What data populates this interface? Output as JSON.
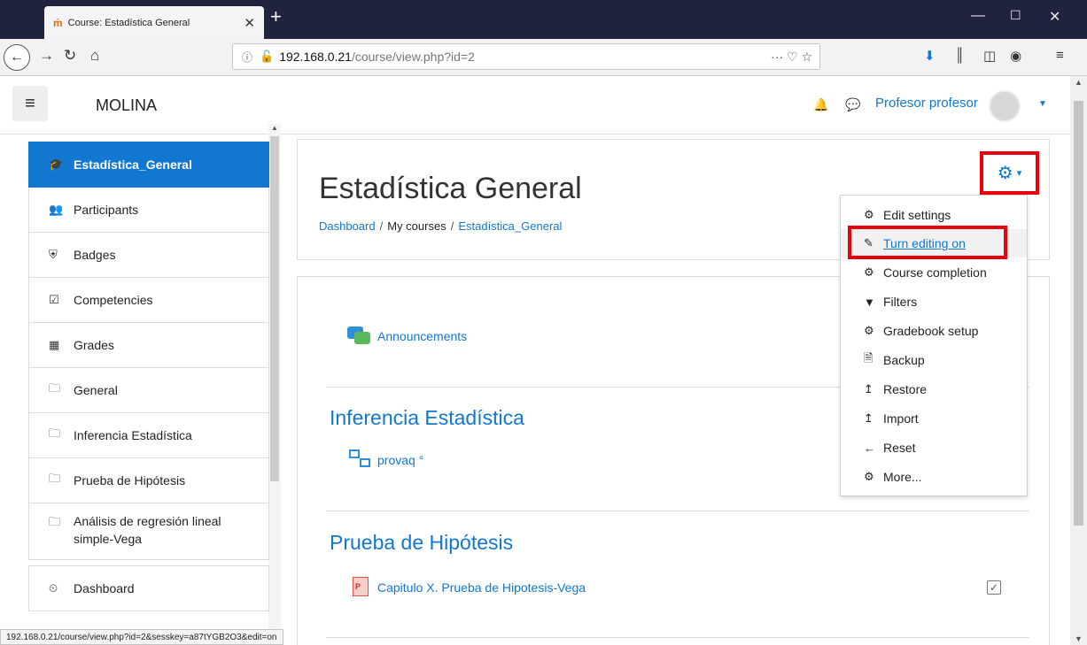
{
  "browser": {
    "tab_title": "Course: Estadística General",
    "tab_favicon": "ṁ",
    "url_host": "192.168.0.21",
    "url_path": "/course/view.php?id=2",
    "status_url": "192.168.0.21/course/view.php?id=2&sesskey=a87tYGB2O3&edit=on"
  },
  "header": {
    "site_name": "MOLINA",
    "user_name": "Profesor profesor"
  },
  "sidebar": {
    "items": [
      {
        "icon": "graduation-cap-icon",
        "label": "Estadística_General",
        "active": true
      },
      {
        "icon": "users-icon",
        "label": "Participants"
      },
      {
        "icon": "shield-icon",
        "label": "Badges"
      },
      {
        "icon": "check-square-icon",
        "label": "Competencies"
      },
      {
        "icon": "table-icon",
        "label": "Grades"
      },
      {
        "icon": "folder-icon",
        "label": "General"
      },
      {
        "icon": "folder-icon",
        "label": "Inferencia Estadística"
      },
      {
        "icon": "folder-icon",
        "label": "Prueba de Hipótesis"
      },
      {
        "icon": "folder-icon",
        "label": "Análisis de regresión lineal simple-Vega"
      }
    ],
    "dashboard_label": "Dashboard"
  },
  "course": {
    "title": "Estadística General",
    "breadcrumb": [
      "Dashboard",
      "My courses",
      "Estadística_General"
    ]
  },
  "menu": {
    "items": [
      {
        "icon": "gear-icon",
        "label": "Edit settings"
      },
      {
        "icon": "pencil-icon",
        "label": "Turn editing on",
        "highlighted": true
      },
      {
        "icon": "gear-icon",
        "label": "Course completion"
      },
      {
        "icon": "filter-icon",
        "label": "Filters"
      },
      {
        "icon": "gear-icon",
        "label": "Gradebook setup"
      },
      {
        "icon": "file-archive-icon",
        "label": "Backup"
      },
      {
        "icon": "level-up-icon",
        "label": "Restore"
      },
      {
        "icon": "level-up-icon",
        "label": "Import"
      },
      {
        "icon": "arrow-left-icon",
        "label": "Reset"
      },
      {
        "icon": "gear-icon",
        "label": "More..."
      }
    ]
  },
  "content": {
    "announcements": "Announcements",
    "section1_title": "Inferencia Estadística",
    "quiz_label": "provaq °",
    "section2_title": "Prueba de Hipótesis",
    "resource_label": "Capitulo X. Prueba de Hipotesis-Vega"
  },
  "colors": {
    "accent": "#1177d1",
    "highlight_box": "#e8000b",
    "titlebar": "#202340"
  }
}
